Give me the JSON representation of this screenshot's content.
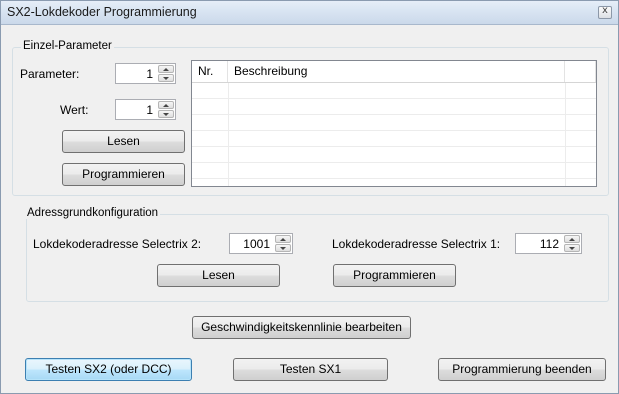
{
  "window": {
    "title": "SX2-Lokdekoder Programmierung",
    "close_glyph": "x"
  },
  "einzel": {
    "group_label": "Einzel-Parameter",
    "parameter_label": "Parameter:",
    "parameter_value": "1",
    "wert_label": "Wert:",
    "wert_value": "1",
    "lesen_label": "Lesen",
    "programmieren_label": "Programmieren",
    "table": {
      "columns": [
        "Nr.",
        "Beschreibung",
        ""
      ],
      "rows": []
    }
  },
  "adress": {
    "group_label": "Adressgrundkonfiguration",
    "sx2_label": "Lokdekoderadresse Selectrix 2:",
    "sx2_value": "1001",
    "sx1_label": "Lokdekoderadresse Selectrix 1:",
    "sx1_value": "112",
    "lesen_label": "Lesen",
    "programmieren_label": "Programmieren"
  },
  "actions": {
    "kennlinie_label": "Geschwindigkeitskennlinie bearbeiten",
    "test_sx2_label": "Testen SX2 (oder DCC)",
    "test_sx1_label": "Testen SX1",
    "beenden_label": "Programmierung beenden"
  },
  "icons": {
    "spin_up": "spin-up-arrow-icon",
    "spin_down": "spin-down-arrow-icon",
    "close": "close-icon"
  },
  "colors": {
    "window_bg": "#f0f0f0",
    "titlebar": "#d8e4f2",
    "focus_button": "#bee6fd",
    "groupbox_border": "#d5dfe5"
  }
}
